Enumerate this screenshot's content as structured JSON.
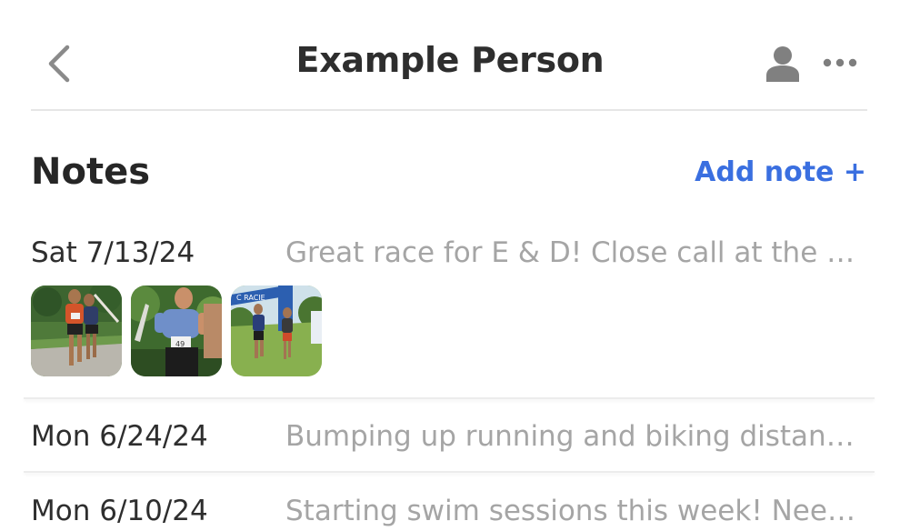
{
  "header": {
    "title": "Example Person",
    "back_icon": "chevron-left-icon",
    "person_icon": "person-icon",
    "more_icon": "more-horizontal-icon"
  },
  "notes_section": {
    "title": "Notes",
    "add_label": "Add note +",
    "accent_color": "#3a6fe0"
  },
  "notes": [
    {
      "date": "Sat 7/13/24",
      "preview": "Great race for E & D! Close call at the finis…",
      "photos": 3
    },
    {
      "date": "Mon 6/24/24",
      "preview": "Bumping up running and biking distances…"
    },
    {
      "date": "Mon 6/10/24",
      "preview": "Starting swim sessions this week! Need t…"
    }
  ]
}
